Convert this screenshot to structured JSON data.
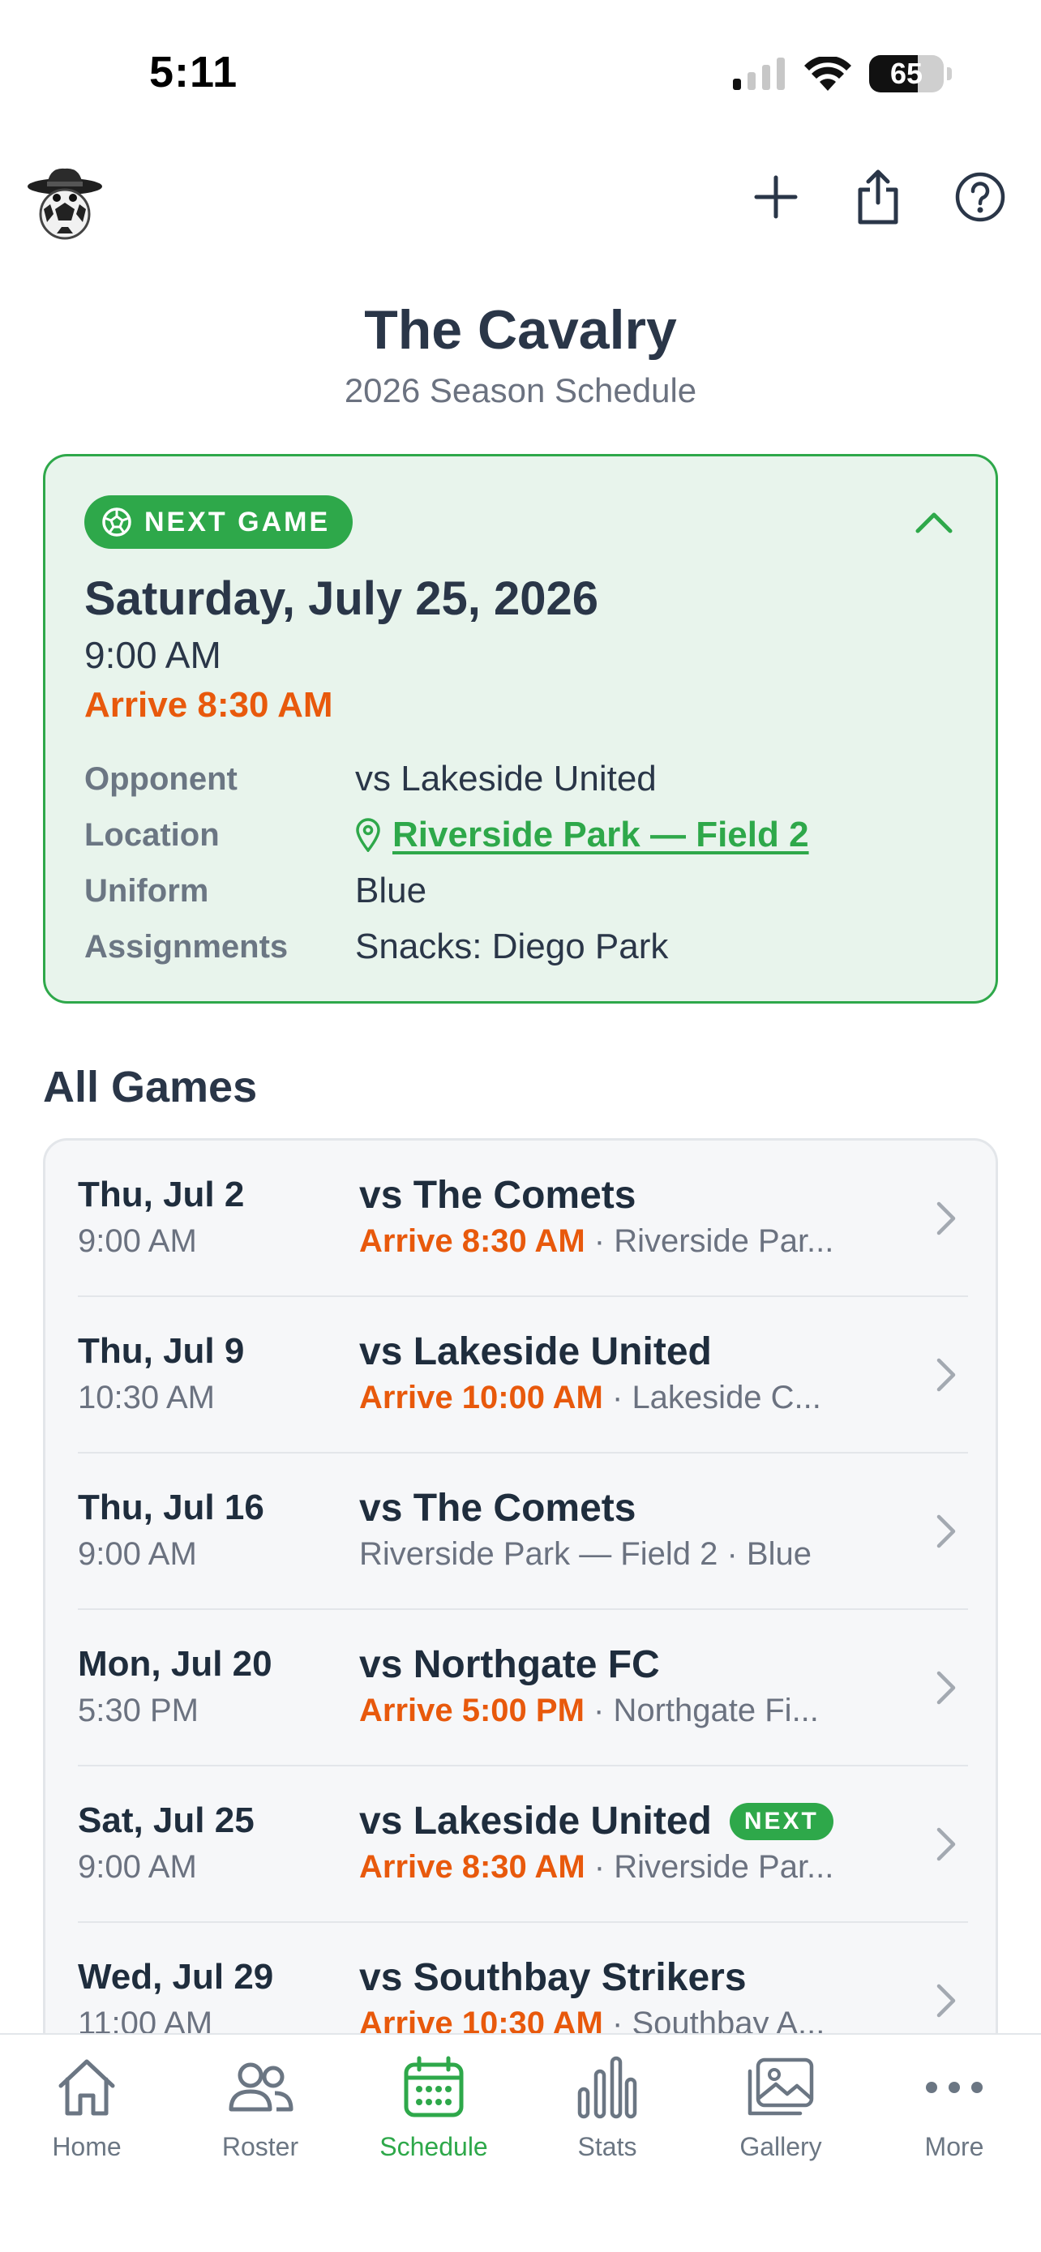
{
  "status_bar": {
    "time": "5:11",
    "battery": 65
  },
  "team": {
    "name": "The Cavalry",
    "subtitle": "2026 Season Schedule"
  },
  "next_game": {
    "badge": "NEXT GAME",
    "date": "Saturday, July 25, 2026",
    "time": "9:00 AM",
    "arrive": "Arrive 8:30 AM",
    "details": [
      {
        "label": "Opponent",
        "value": "vs Lakeside United"
      },
      {
        "label": "Location",
        "value": "Riverside Park — Field 2"
      },
      {
        "label": "Uniform",
        "value": "Blue"
      },
      {
        "label": "Assignments",
        "value": "Snacks: Diego Park"
      }
    ]
  },
  "all_games": {
    "title": "All Games",
    "games": [
      {
        "date": "Thu, Jul 2",
        "time": "9:00 AM",
        "opponent": "vs The Comets",
        "arrive": "Arrive 8:30 AM",
        "sep": " · ",
        "info": "Riverside Par...",
        "next": ""
      },
      {
        "date": "Thu, Jul 9",
        "time": "10:30 AM",
        "opponent": "vs Lakeside United",
        "arrive": "Arrive 10:00 AM",
        "sep": " · ",
        "info": "Lakeside C...",
        "next": ""
      },
      {
        "date": "Thu, Jul 16",
        "time": "9:00 AM",
        "opponent": "vs The Comets",
        "arrive": "",
        "sep": "",
        "info": "Riverside Park — Field 2 · Blue",
        "next": ""
      },
      {
        "date": "Mon, Jul 20",
        "time": "5:30 PM",
        "opponent": "vs Northgate FC",
        "arrive": "Arrive 5:00 PM",
        "sep": " · ",
        "info": "Northgate Fi...",
        "next": ""
      },
      {
        "date": "Sat, Jul 25",
        "time": "9:00 AM",
        "opponent": "vs Lakeside United",
        "arrive": "Arrive 8:30 AM",
        "sep": " · ",
        "info": "Riverside Par...",
        "next": "NEXT"
      },
      {
        "date": "Wed, Jul 29",
        "time": "11:00 AM",
        "opponent": "vs Southbay Strikers",
        "arrive": "Arrive 10:30 AM",
        "sep": " · ",
        "info": "Southbay A...",
        "next": ""
      }
    ]
  },
  "tabs": [
    {
      "label": "Home",
      "icon": "home-icon"
    },
    {
      "label": "Roster",
      "icon": "roster-icon"
    },
    {
      "label": "Schedule",
      "icon": "calendar-icon",
      "active": true
    },
    {
      "label": "Stats",
      "icon": "stats-icon"
    },
    {
      "label": "Gallery",
      "icon": "gallery-icon"
    },
    {
      "label": "More",
      "icon": "more-icon"
    }
  ],
  "colors": {
    "accent": "#2ea84a",
    "arrive": "#e8590c",
    "card_bg": "#e8f4ec",
    "title": "#2a3648"
  }
}
